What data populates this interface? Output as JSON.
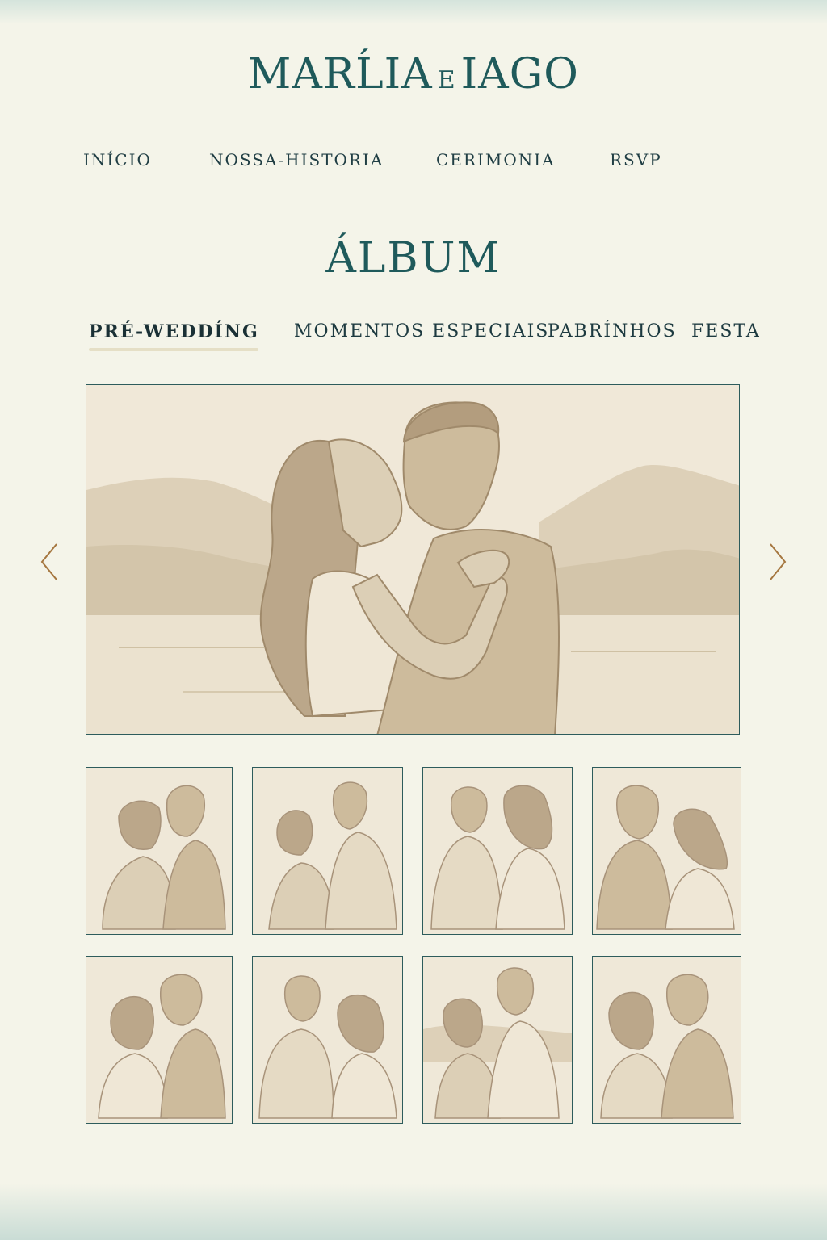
{
  "site": {
    "name_left": "MARĹIA",
    "name_joiner": "E",
    "name_right": "IAGO"
  },
  "nav": {
    "items": [
      {
        "label": "INÍCIO"
      },
      {
        "label": "NOSSA-HISTORIA"
      },
      {
        "label": "CERIMONIA"
      },
      {
        "label": "RSVP"
      }
    ]
  },
  "album": {
    "title": "ÁLBUM",
    "tabs": [
      {
        "label": "PRÉ-WEDDÍNG",
        "active": true
      },
      {
        "label": "MOMENTOS ESPECIAIS",
        "active": false
      },
      {
        "label": "PABRÍNHOS",
        "active": false
      },
      {
        "label": "FESTA",
        "active": false
      }
    ],
    "active_tab": "PRÉ-WEDDÍNG",
    "hero_image": "couple-kissing-by-lake-illustration",
    "thumbnails": [
      "couple-kissing",
      "couple-embracing",
      "couple-side-by-side",
      "couple-facing",
      "couple-close",
      "couple-standing",
      "couple-by-lake",
      "couple-hug"
    ],
    "prev_icon": "chevron-left-icon",
    "next_icon": "chevron-right-icon"
  },
  "colors": {
    "background": "#f4f4e9",
    "accent": "#1f5a5b",
    "frame": "#2d5c5c",
    "arrow": "#a5763f",
    "sepia": "#c9b89a"
  }
}
